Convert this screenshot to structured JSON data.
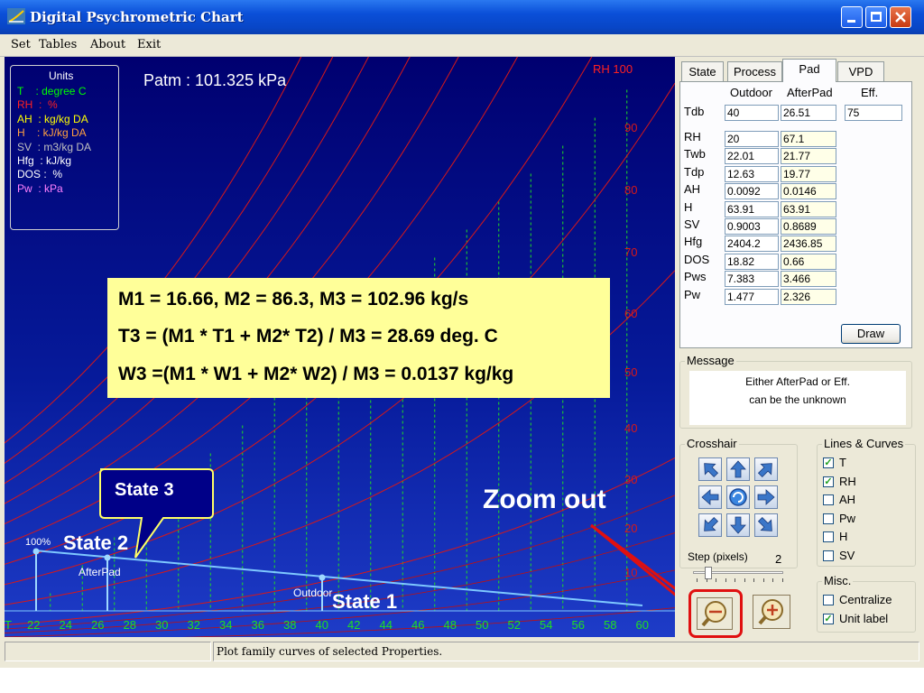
{
  "window": {
    "title": "Digital Psychrometric Chart"
  },
  "menu": [
    {
      "label": "Set"
    },
    {
      "label": "Tables"
    },
    {
      "label": "About"
    },
    {
      "label": "Exit"
    }
  ],
  "plot": {
    "patm": "Patm : 101.325  kPa",
    "units": {
      "title": "Units",
      "rows": [
        {
          "text": "T    : degree C",
          "color": "#00ff00"
        },
        {
          "text": "RH  :  %",
          "color": "#ff2020"
        },
        {
          "text": "AH  : kg/kg DA",
          "color": "#ffff00"
        },
        {
          "text": "H    : kJ/kg DA",
          "color": "#ffa040"
        },
        {
          "text": "SV  : m3/kg DA",
          "color": "#c0c0c0"
        },
        {
          "text": "Hfg  : kJ/kg",
          "color": "#ffffff"
        },
        {
          "text": "DOS :  %",
          "color": "#ffffff"
        },
        {
          "text": "Pw  : kPa",
          "color": "#ff80ff"
        }
      ]
    },
    "rh_label": "RH 100",
    "rh_ticks": [
      "90",
      "80",
      "70",
      "60",
      "50",
      "40",
      "30",
      "20",
      "10"
    ],
    "x_ticks": [
      "T",
      "22",
      "24",
      "26",
      "28",
      "30",
      "32",
      "34",
      "36",
      "38",
      "40",
      "42",
      "44",
      "46",
      "48",
      "50",
      "52",
      "54",
      "56",
      "58",
      "60"
    ],
    "label_100": "100%",
    "label_afterpad": "AfterPad",
    "label_outdoor": "Outdoor"
  },
  "equations": {
    "line1": "M1 = 16.66,  M2 = 86.3,  M3 = 102.96 kg/s",
    "line2": "T3 = (M1 * T1 + M2* T2) / M3 = 28.69 deg. C",
    "line3": "W3 =(M1 * W1 + M2* W2) / M3 =  0.0137 kg/kg"
  },
  "callouts": {
    "state1": "State 1",
    "state2": "State 2",
    "state3": "State 3",
    "zoom": "Zoom out"
  },
  "tabs": [
    {
      "label": "State",
      "active": false
    },
    {
      "label": "Process",
      "active": false
    },
    {
      "label": "Pad",
      "active": true
    },
    {
      "label": "VPD",
      "active": false
    }
  ],
  "pad": {
    "col_outdoor": "Outdoor",
    "col_afterpad": "AfterPad",
    "col_eff": "Eff.",
    "tdb": {
      "label": "Tdb",
      "outdoor": "40",
      "afterpad": "26.51",
      "eff": "75"
    },
    "rows": [
      {
        "label": "RH",
        "outdoor": "20",
        "afterpad": "67.1"
      },
      {
        "label": "Twb",
        "outdoor": "22.01",
        "afterpad": "21.77"
      },
      {
        "label": "Tdp",
        "outdoor": "12.63",
        "afterpad": "19.77"
      },
      {
        "label": "AH",
        "outdoor": "0.0092",
        "afterpad": "0.0146"
      },
      {
        "label": "H",
        "outdoor": "63.91",
        "afterpad": "63.91"
      },
      {
        "label": "SV",
        "outdoor": "0.9003",
        "afterpad": "0.8689"
      },
      {
        "label": "Hfg",
        "outdoor": "2404.2",
        "afterpad": "2436.85"
      },
      {
        "label": "DOS",
        "outdoor": "18.82",
        "afterpad": "0.66"
      },
      {
        "label": "Pws",
        "outdoor": "7.383",
        "afterpad": "3.466"
      },
      {
        "label": "Pw",
        "outdoor": "1.477",
        "afterpad": "2.326"
      }
    ],
    "draw": "Draw"
  },
  "message": {
    "label": "Message",
    "line1": "Either AfterPad or Eff.",
    "line2": "can be the unknown"
  },
  "crosshair": {
    "label": "Crosshair",
    "step_label": "Step (pixels)",
    "step_value": "2"
  },
  "lines_curves": {
    "label": "Lines & Curves",
    "items": [
      {
        "label": "T",
        "checked": "✓"
      },
      {
        "label": "RH",
        "checked": "✓"
      },
      {
        "label": "AH",
        "checked": ""
      },
      {
        "label": "Pw",
        "checked": ""
      },
      {
        "label": "H",
        "checked": ""
      },
      {
        "label": "SV",
        "checked": ""
      }
    ]
  },
  "misc": {
    "label": "Misc.",
    "items": [
      {
        "label": "Centralize",
        "checked": ""
      },
      {
        "label": "Unit label",
        "checked": "✓"
      }
    ]
  },
  "status": {
    "text": "Plot family curves of selected Properties."
  }
}
